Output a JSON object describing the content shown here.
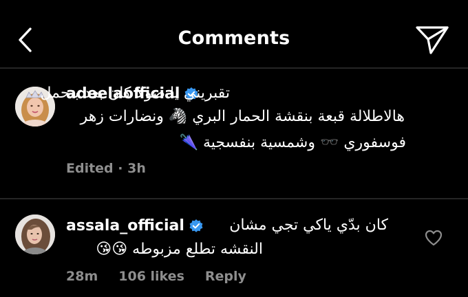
{
  "header": {
    "title": "Comments",
    "back_icon": "chevron-left-icon",
    "share_icon": "send-icon"
  },
  "comments": [
    {
      "username": "adeelaofficial",
      "verified": true,
      "line1": "تقبريني يا صولا كان بعد بتحمل",
      "line2": "هالاطلالة قبعة بنقشة الحمار البري 🦓 ونضارات زهر",
      "line3": "فوسفوري 🕶️ وشمسية بنفسجية 🌂",
      "meta": "Edited · 3h"
    },
    {
      "username": "assala_official",
      "verified": true,
      "line1": "كان بدّي ياكي تجي مشان",
      "line2": "النقشه تطلع مزبوطه 😘😘",
      "time": "28m",
      "likes": "106 likes",
      "reply": "Reply"
    }
  ],
  "colors": {
    "background": "#000000",
    "text": "#ffffff",
    "secondary": "#8e8e8e",
    "divider": "#262626",
    "verified": "#3897f0"
  }
}
